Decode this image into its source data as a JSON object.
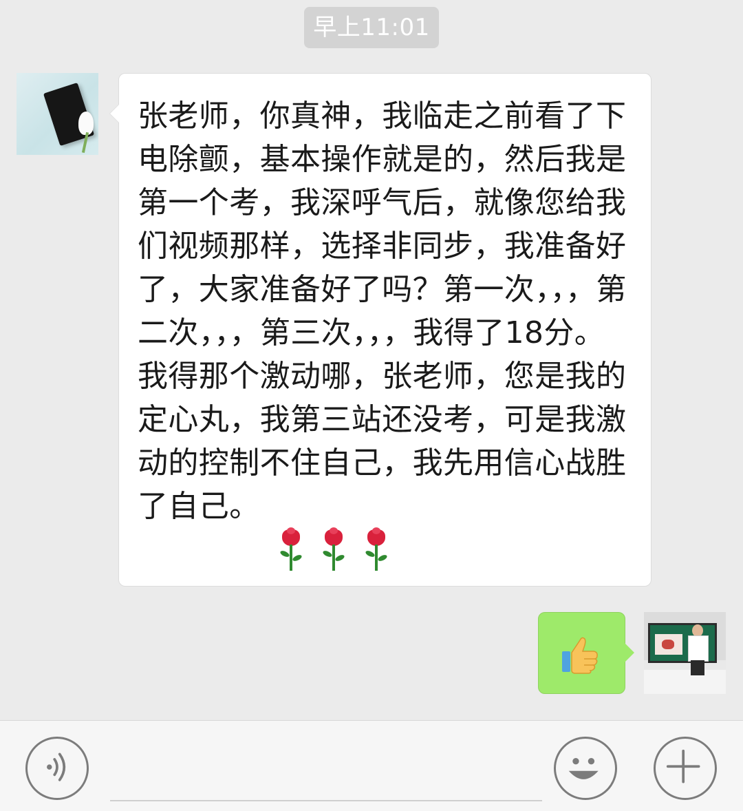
{
  "chat": {
    "timestamp": "早上11:01",
    "incoming_message": {
      "text": "张老师，你真神，我临走之前看了下电除颤，基本操作就是的，然后我是第一个考，我深呼气后，就像您给我们视频那样，选择非同步，我准备好了，大家准备好了吗？第一次，，，第二次，，，第三次，，，我得了18分。我得那个激动哪，张老师，您是我的定心丸，我第三站还没考，可是我激动的控制不住自己，我先用信心战胜了自己。",
      "emoji_names": [
        "rose-emoji",
        "rose-emoji",
        "rose-emoji"
      ]
    },
    "outgoing_message": {
      "emoji_name": "thumbs-up-emoji"
    }
  },
  "colors": {
    "chat_background": "#ebebeb",
    "incoming_bubble": "#ffffff",
    "outgoing_bubble": "#9eea6a",
    "timestamp_pill": "#d3d3d3"
  },
  "input_bar": {
    "left_button_icon": "voice-icon",
    "emoji_button_icon": "emoji-icon",
    "plus_button_icon": "plus-icon"
  }
}
